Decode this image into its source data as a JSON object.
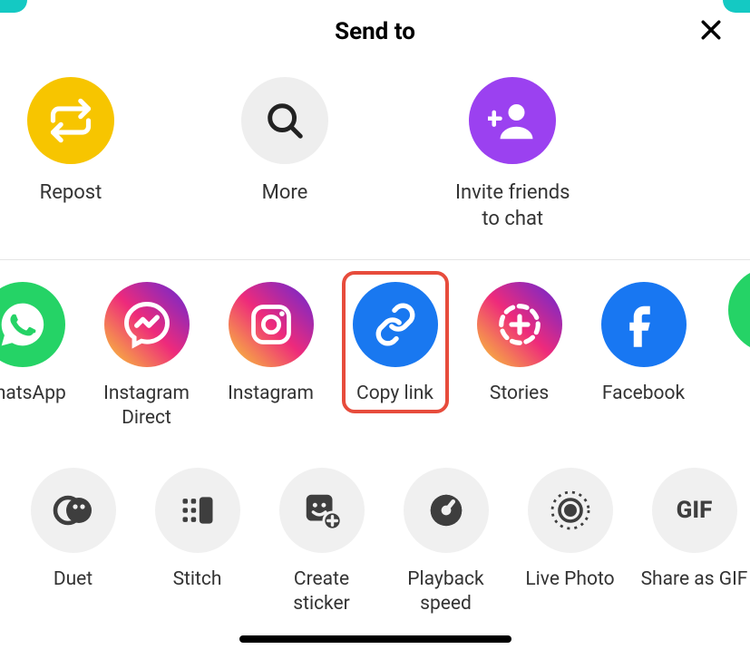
{
  "header": {
    "title": "Send to"
  },
  "top_actions": {
    "repost": {
      "label": "Repost"
    },
    "more": {
      "label": "More"
    },
    "invite": {
      "label": "Invite friends\nto chat"
    }
  },
  "share_targets": {
    "whatsapp": {
      "label": "WhatsApp"
    },
    "instagram_direct": {
      "label": "Instagram\nDirect"
    },
    "instagram": {
      "label": "Instagram"
    },
    "copy_link": {
      "label": "Copy link"
    },
    "stories": {
      "label": "Stories"
    },
    "facebook": {
      "label": "Facebook"
    }
  },
  "bottom_actions": {
    "duet": {
      "label": "Duet"
    },
    "stitch": {
      "label": "Stitch"
    },
    "create_sticker": {
      "label": "Create\nsticker"
    },
    "playback_speed": {
      "label": "Playback\nspeed"
    },
    "live_photo": {
      "label": "Live Photo"
    },
    "share_gif": {
      "label": "Share as GIF",
      "icon_text": "GIF"
    }
  }
}
